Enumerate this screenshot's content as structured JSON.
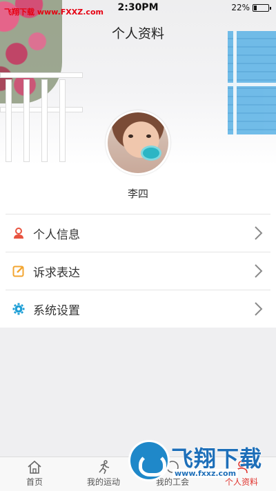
{
  "status": {
    "watermark": "飞翔下载 www.FXXZ.com",
    "time": "2:30PM",
    "battery": "22%",
    "battery_level": 0.22
  },
  "header": {
    "title": "个人资料"
  },
  "profile": {
    "name": "李四"
  },
  "menu": [
    {
      "label": "个人信息",
      "icon": "person-icon",
      "color": "#e8533f"
    },
    {
      "label": "诉求表达",
      "icon": "edit-icon",
      "color": "#f3a530"
    },
    {
      "label": "系统设置",
      "icon": "gear-icon",
      "color": "#1f9fd6"
    }
  ],
  "tabbar": {
    "tabs": [
      {
        "label": "首页",
        "icon": "home-icon",
        "active": false
      },
      {
        "label": "我的运动",
        "icon": "runner-icon",
        "active": false
      },
      {
        "label": "我的工会",
        "icon": "union-icon",
        "active": false
      },
      {
        "label": "个人资料",
        "icon": "profile-icon",
        "active": true
      }
    ]
  },
  "brand": {
    "name": "飞翔下载",
    "url": "www.fxxz.com"
  },
  "colors": {
    "accent": "#e0332d",
    "brand_blue": "#1e6fb9"
  }
}
